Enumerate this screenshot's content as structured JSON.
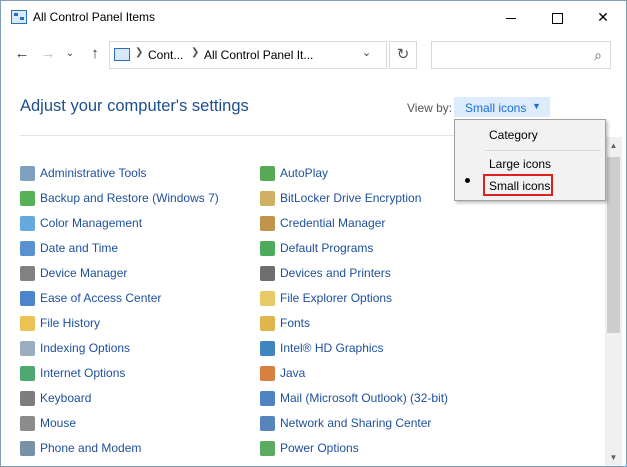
{
  "window": {
    "title": "All Control Panel Items"
  },
  "address": {
    "crumbs": [
      "Cont...",
      "All Control Panel It..."
    ],
    "search_placeholder": ""
  },
  "heading": "Adjust your computer's settings",
  "view_by": {
    "label": "View by:",
    "selected": "Small icons"
  },
  "view_menu": {
    "options": [
      "Category",
      "Large icons",
      "Small icons"
    ],
    "checked": "Small icons"
  },
  "items_left": [
    {
      "label": "Administrative Tools",
      "icon": "admin-tools-icon",
      "color": "#6a8fb5"
    },
    {
      "label": "Backup and Restore (Windows 7)",
      "icon": "backup-icon",
      "color": "#3aa53a"
    },
    {
      "label": "Color Management",
      "icon": "color-management-icon",
      "color": "#4a9bd6"
    },
    {
      "label": "Date and Time",
      "icon": "clock-icon",
      "color": "#3d7fc9"
    },
    {
      "label": "Device Manager",
      "icon": "device-manager-icon",
      "color": "#6b6b6b"
    },
    {
      "label": "Ease of Access Center",
      "icon": "ease-of-access-icon",
      "color": "#2f6fbf"
    },
    {
      "label": "File History",
      "icon": "file-history-icon",
      "color": "#e8b935"
    },
    {
      "label": "Indexing Options",
      "icon": "indexing-icon",
      "color": "#8aa0b5"
    },
    {
      "label": "Internet Options",
      "icon": "internet-options-icon",
      "color": "#2f9a58"
    },
    {
      "label": "Keyboard",
      "icon": "keyboard-icon",
      "color": "#666666"
    },
    {
      "label": "Mouse",
      "icon": "mouse-icon",
      "color": "#777777"
    },
    {
      "label": "Phone and Modem",
      "icon": "phone-modem-icon",
      "color": "#5f7f97"
    }
  ],
  "items_right": [
    {
      "label": "AutoPlay",
      "icon": "autoplay-icon",
      "color": "#3a9a3a"
    },
    {
      "label": "BitLocker Drive Encryption",
      "icon": "bitlocker-icon",
      "color": "#c8a24a"
    },
    {
      "label": "Credential Manager",
      "icon": "credential-manager-icon",
      "color": "#b5812b"
    },
    {
      "label": "Default Programs",
      "icon": "default-programs-icon",
      "color": "#2e9d3f"
    },
    {
      "label": "Devices and Printers",
      "icon": "printer-icon",
      "color": "#555555"
    },
    {
      "label": "File Explorer Options",
      "icon": "folder-options-icon",
      "color": "#e3c04d"
    },
    {
      "label": "Fonts",
      "icon": "fonts-icon",
      "color": "#d9a92e"
    },
    {
      "label": "Intel® HD Graphics",
      "icon": "intel-graphics-icon",
      "color": "#1f6fb5"
    },
    {
      "label": "Java",
      "icon": "java-icon",
      "color": "#d06a1e"
    },
    {
      "label": "Mail (Microsoft Outlook) (32-bit)",
      "icon": "mail-icon",
      "color": "#2f6fb8"
    },
    {
      "label": "Network and Sharing Center",
      "icon": "network-icon",
      "color": "#3b6fb0"
    },
    {
      "label": "Power Options",
      "icon": "power-options-icon",
      "color": "#3d9b47"
    }
  ]
}
